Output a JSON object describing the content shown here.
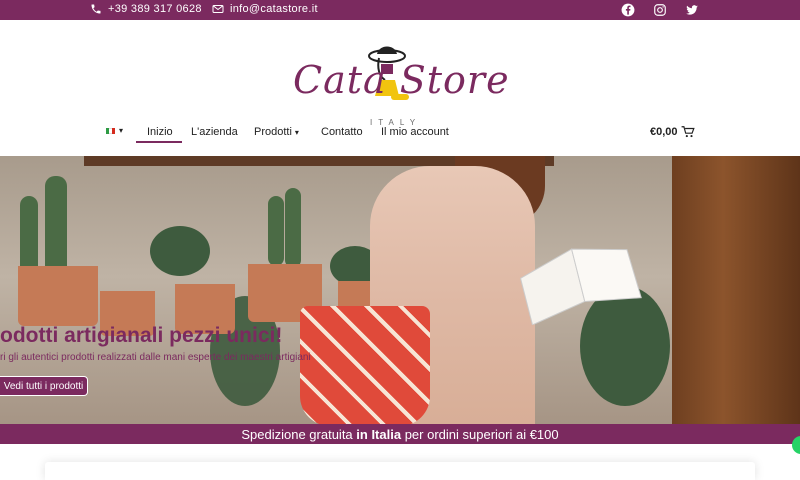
{
  "topbar": {
    "phone": "+39 389 317 0628",
    "email": "info@catastore.it",
    "social": [
      "facebook-icon",
      "instagram-icon",
      "twitter-icon"
    ]
  },
  "logo": {
    "text": "Cata Store",
    "subtitle": "ITALY"
  },
  "nav": {
    "items": [
      {
        "label": "Inizio"
      },
      {
        "label": "L'azienda"
      },
      {
        "label": "Prodotti"
      },
      {
        "label": "Contatto"
      },
      {
        "label": "Il mio account"
      }
    ],
    "cart_total": "€0,00"
  },
  "hero": {
    "title": "odotti artigianali pezzi unici!",
    "subtitle": "ri gli autentici prodotti realizzati dalle mani esperte dei maestri artigiani",
    "button": "Vedi tutti i prodotti"
  },
  "banner": {
    "prefix": "Spedizione gratuita ",
    "highlight": "in Italia",
    "suffix": " per ordini superiori ai €100"
  },
  "colors": {
    "brand": "#7b2a5f",
    "accent": "#f1c40f",
    "chat": "#25d366"
  }
}
